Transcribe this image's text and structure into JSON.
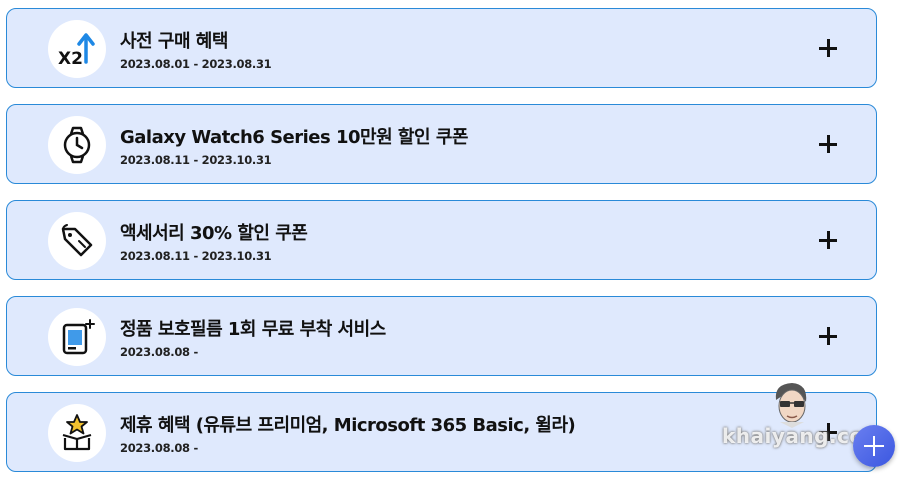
{
  "benefits": [
    {
      "title": "사전 구매 혜택",
      "date": "2023.08.01 - 2023.08.31",
      "icon": "x2-arrow-icon",
      "icon_text": "X2"
    },
    {
      "title": "Galaxy Watch6 Series 10만원 할인 쿠폰",
      "date": "2023.08.11 - 2023.10.31",
      "icon": "watch-icon"
    },
    {
      "title": "액세서리 30% 할인 쿠폰",
      "date": "2023.08.11 - 2023.10.31",
      "icon": "price-tag-icon"
    },
    {
      "title": "정품 보호필름 1회 무료 부착 서비스",
      "date": "2023.08.08 -",
      "icon": "screen-protector-icon"
    },
    {
      "title": "제휴 혜택 (유튜브 프리미엄, Microsoft 365 Basic, 윌라)",
      "date": "2023.08.08 -",
      "icon": "gift-box-star-icon"
    }
  ],
  "watermark": {
    "text": "khaiyang.com"
  },
  "colors": {
    "card_bg": "#dfe9fd",
    "card_border": "#2a8ad8",
    "accent": "#1e88e5",
    "fab": "#4a63e6"
  }
}
